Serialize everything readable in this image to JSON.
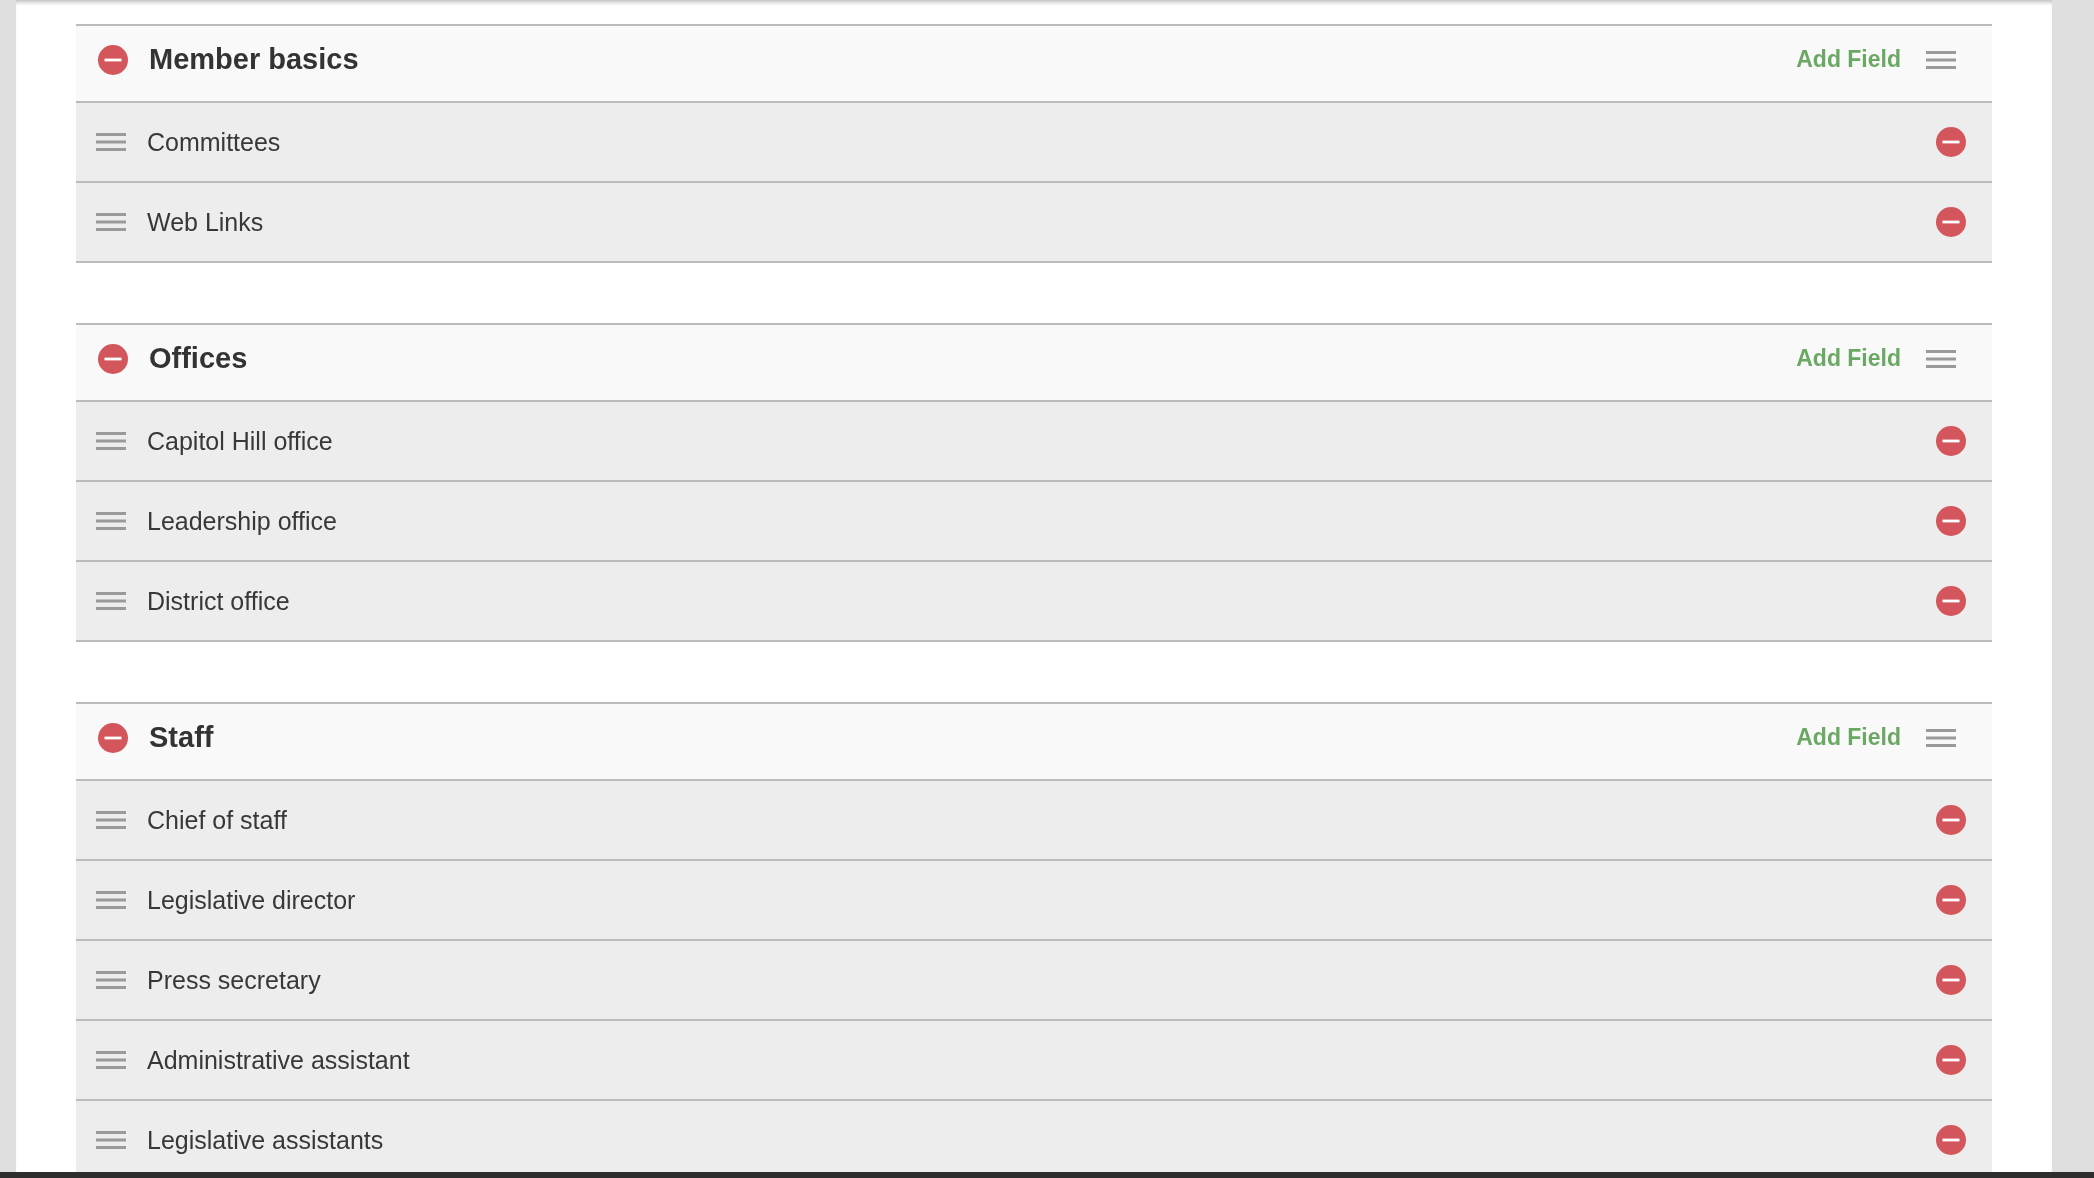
{
  "sections": [
    {
      "title": "Member basics",
      "action": "Add Field",
      "fields": [
        "Committees",
        "Web Links"
      ]
    },
    {
      "title": "Offices",
      "action": "Add Field",
      "fields": [
        "Capitol Hill office",
        "Leadership office",
        "District office"
      ]
    },
    {
      "title": "Staff",
      "action": "Add Field",
      "fields": [
        "Chief of staff",
        "Legislative director",
        "Press secretary",
        "Administrative assistant",
        "Legislative assistants"
      ]
    }
  ]
}
